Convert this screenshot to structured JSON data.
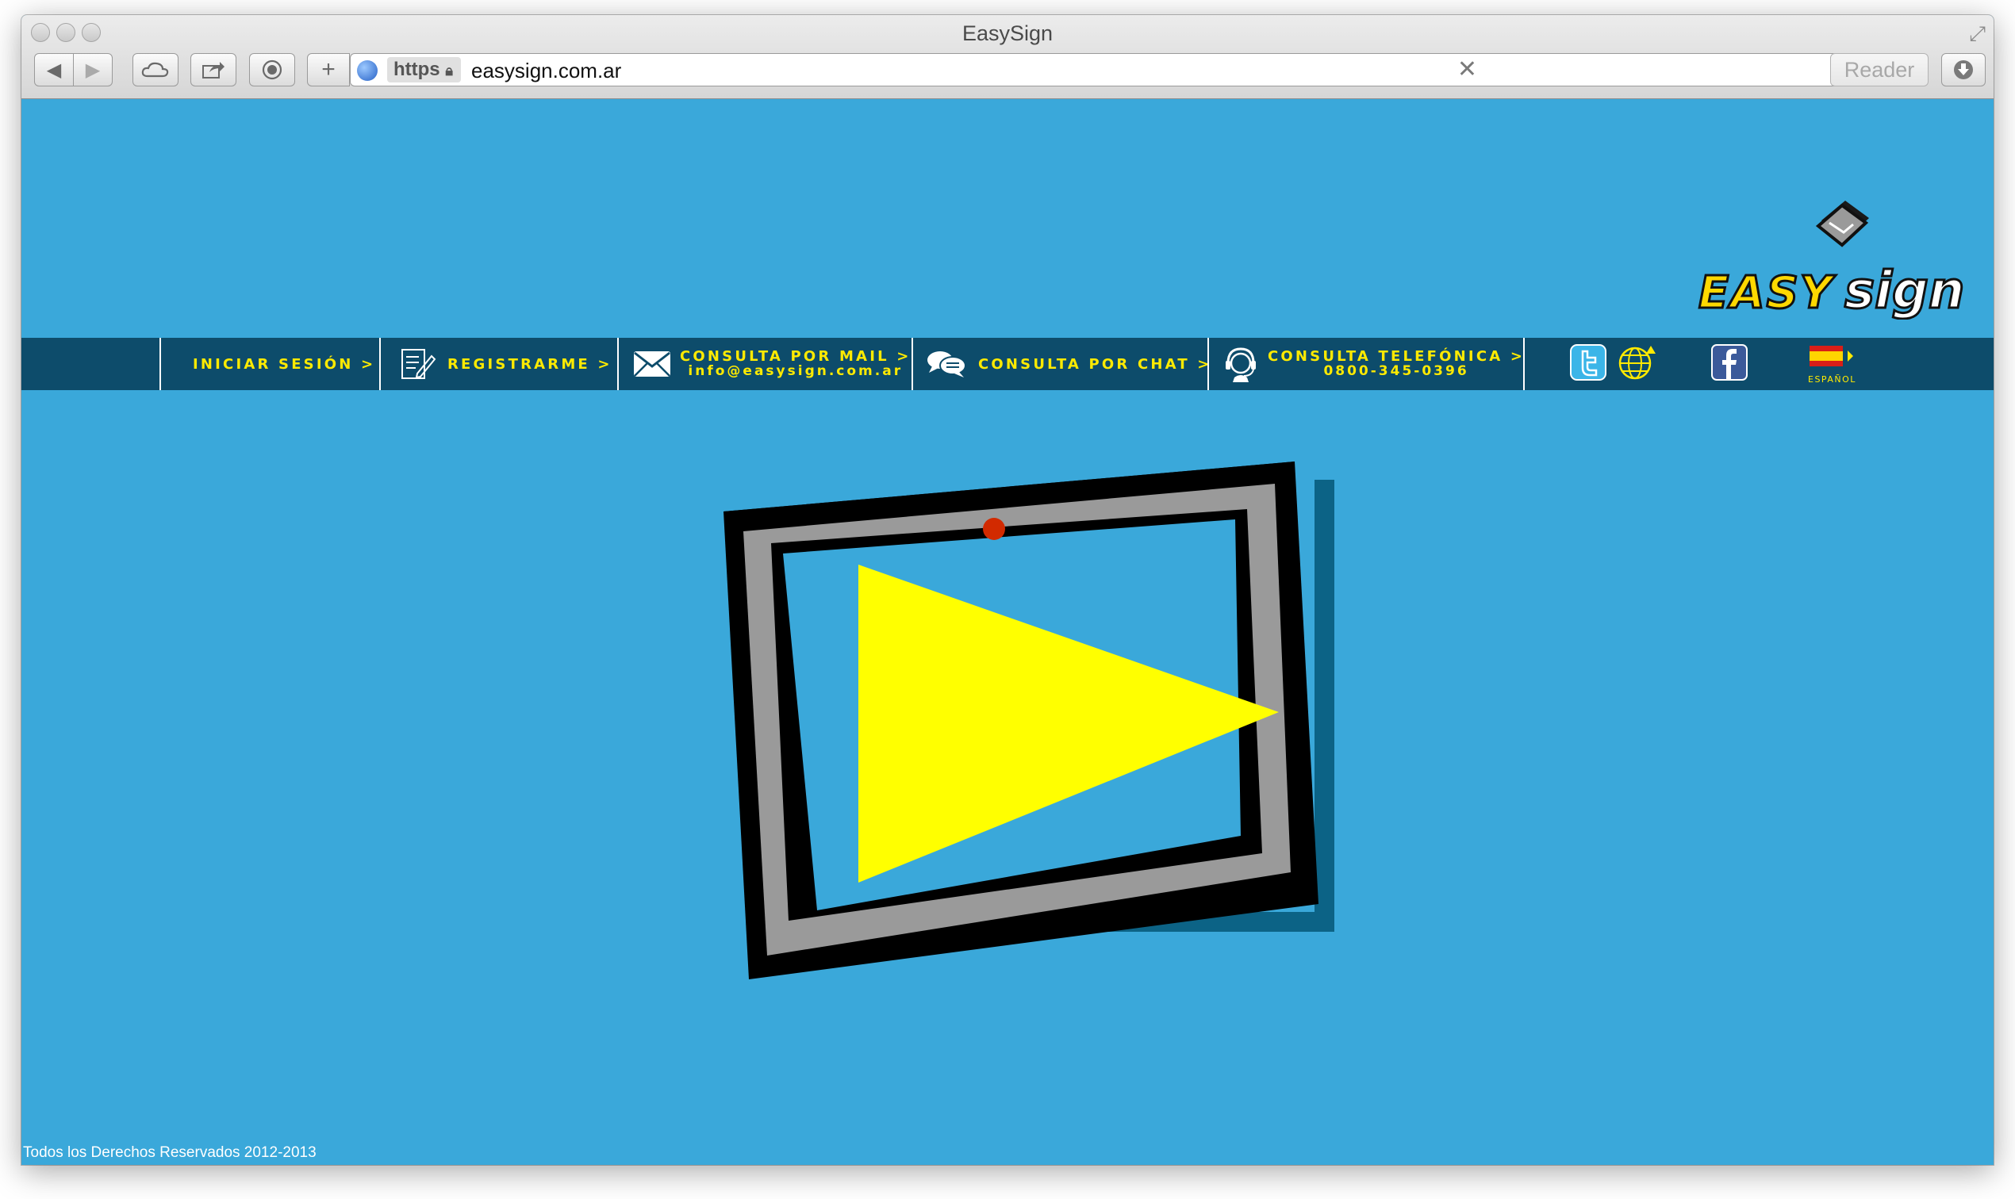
{
  "browser": {
    "window_title": "EasySign",
    "url_scheme": "https",
    "url": "easysign.com.ar",
    "reader_label": "Reader",
    "icons": [
      "back-icon",
      "forward-icon",
      "icloud-tabs-icon",
      "share-icon",
      "stop-icon",
      "add-bookmark-icon",
      "globe-icon",
      "lock-icon",
      "clear-icon",
      "downloads-icon",
      "fullscreen-icon"
    ]
  },
  "site": {
    "logo_text": "EASY sign",
    "nav": {
      "login": "INICIAR SESIÓN >",
      "register": "REGISTRARME >",
      "mail": "CONSULTA POR MAIL >",
      "mail_address": "info@easysign.com.ar",
      "chat": "CONSULTA POR CHAT >",
      "phone": "CONSULTA TELEFÓNICA >",
      "phone_number": "0800-345-0396",
      "language": "ESPAÑOL"
    },
    "social_icons": [
      "twitter-icon",
      "globe-web-icon",
      "facebook-icon",
      "spain-flag-icon"
    ],
    "footer": "Todos los Derechos Reservados 2012-2013"
  },
  "colors": {
    "page_background": "#3aa8da",
    "nav_background": "#0d4c6b",
    "nav_text": "#ffea00",
    "play_triangle": "#ffff00",
    "frame_shadow": "#0c6386"
  }
}
